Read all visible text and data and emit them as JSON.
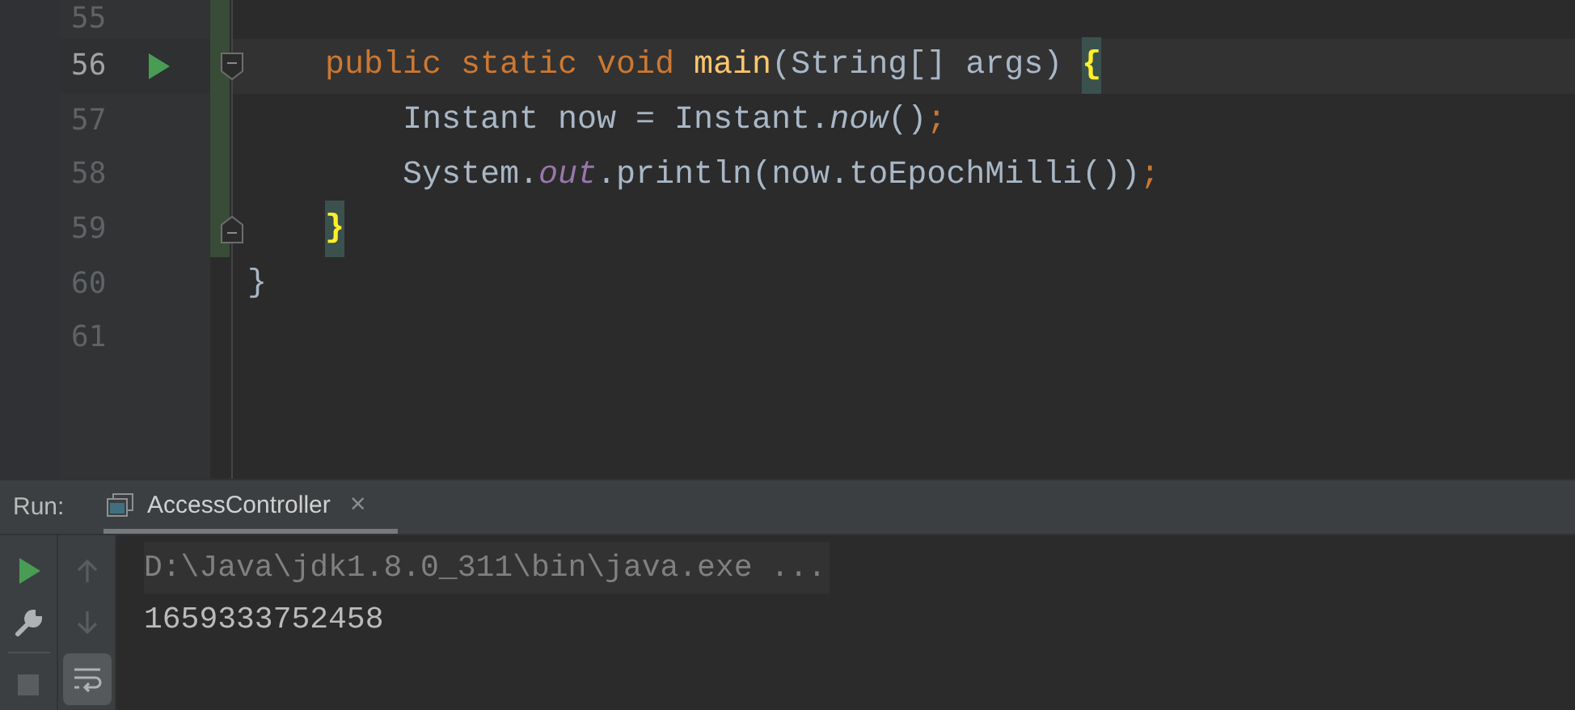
{
  "editor": {
    "lines": [
      {
        "number": "55",
        "current": false,
        "run_marker": false,
        "changed": true,
        "fold_start": false,
        "fold_end": false
      },
      {
        "number": "56",
        "current": true,
        "run_marker": true,
        "changed": true,
        "fold_start": true,
        "fold_end": false,
        "tokens": [
          {
            "text": "    public static void",
            "kind": "keyword"
          },
          {
            "text": " main",
            "kind": "method-decl"
          },
          {
            "text": "(String[] args) ",
            "kind": "plain"
          },
          {
            "text": "{",
            "kind": "matched-brace"
          }
        ]
      },
      {
        "number": "57",
        "current": false,
        "run_marker": false,
        "changed": true,
        "fold_start": false,
        "fold_end": false,
        "tokens": [
          {
            "text": "        Instant now = Instant.",
            "kind": "plain"
          },
          {
            "text": "now",
            "kind": "static-call"
          },
          {
            "text": "()",
            "kind": "plain"
          },
          {
            "text": ";",
            "kind": "keyword"
          }
        ]
      },
      {
        "number": "58",
        "current": false,
        "run_marker": false,
        "changed": true,
        "fold_start": false,
        "fold_end": false,
        "tokens": [
          {
            "text": "        System.",
            "kind": "plain"
          },
          {
            "text": "out",
            "kind": "static-field"
          },
          {
            "text": ".println(now.toEpochMilli())",
            "kind": "plain"
          },
          {
            "text": ";",
            "kind": "keyword"
          }
        ]
      },
      {
        "number": "59",
        "current": false,
        "run_marker": false,
        "changed": true,
        "fold_start": false,
        "fold_end": true,
        "tokens": [
          {
            "text": "    }",
            "kind": "matched-brace"
          }
        ]
      },
      {
        "number": "60",
        "current": false,
        "run_marker": false,
        "changed": false,
        "fold_start": false,
        "fold_end": false,
        "tokens": [
          {
            "text": "}",
            "kind": "plain"
          }
        ]
      },
      {
        "number": "61",
        "current": false,
        "run_marker": false,
        "changed": false,
        "fold_start": false,
        "fold_end": false
      }
    ]
  },
  "run_panel": {
    "label": "Run:",
    "tabs": [
      {
        "label": "AccessController",
        "selected": true,
        "close": "×"
      }
    ],
    "left_tools": [
      {
        "kind": "run",
        "disabled": false
      },
      {
        "kind": "wrench",
        "disabled": false
      },
      {
        "kind": "stop",
        "disabled": true
      }
    ],
    "right_tools": [
      {
        "kind": "up",
        "disabled": true,
        "on": false
      },
      {
        "kind": "down",
        "disabled": true,
        "on": false
      },
      {
        "kind": "soft-wrap",
        "disabled": false,
        "on": true
      }
    ],
    "console": [
      {
        "text": "D:\\Java\\jdk1.8.0_311\\bin\\java.exe ...",
        "kind": "command"
      },
      {
        "text": "1659333752458",
        "kind": "output"
      }
    ]
  }
}
